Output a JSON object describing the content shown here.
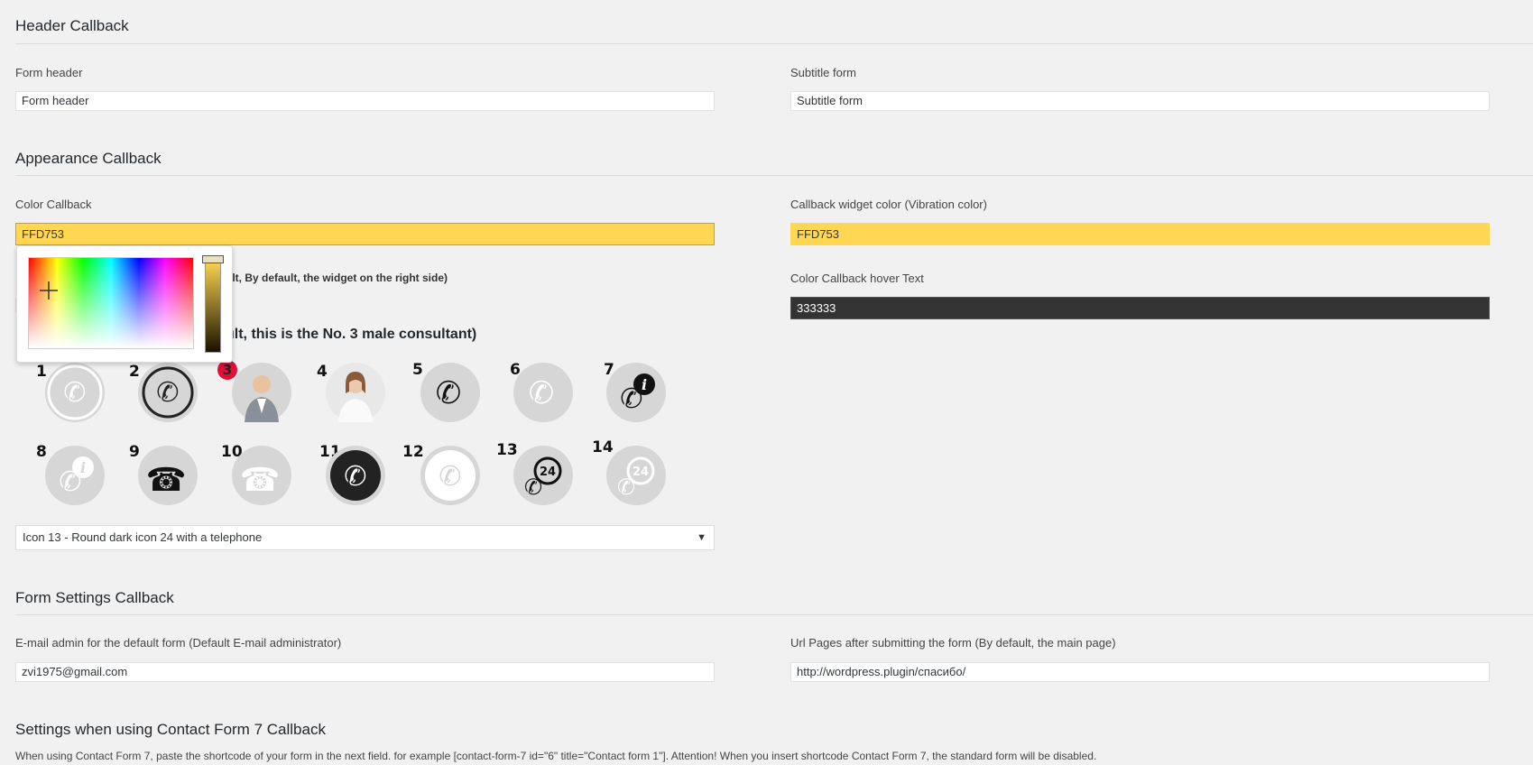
{
  "sections": {
    "header": "Header Callback",
    "appearance": "Appearance Callback",
    "form_settings": "Form Settings Callback",
    "cf7": "Settings when using Contact Form 7 Callback"
  },
  "header_fields": {
    "form_header_label": "Form header",
    "form_header_value": "Form header",
    "subtitle_label": "Subtitle form",
    "subtitle_value": "Subtitle form"
  },
  "appearance": {
    "color_label": "Color Callback",
    "color_value": "FFD753",
    "widget_color_label": "Callback widget color (Vibration color)",
    "widget_color_value": "FFD753",
    "position_label_partial": "ult, By default, the widget on the right side)",
    "hover_text_label": "Color Callback hover Text",
    "hover_text_value": "333333",
    "icon_label_partial": "ult, this is the No. 3 male consultant)",
    "icon_numbers": [
      "1",
      "2",
      "3",
      "4",
      "5",
      "6",
      "7",
      "8",
      "9",
      "10",
      "11",
      "12",
      "13",
      "14"
    ],
    "selected_icon": "Icon 13 - Round dark icon 24 with a telephone",
    "select_arrow": "▼"
  },
  "form_settings": {
    "email_label": "E-mail admin for the default form (Default E-mail administrator)",
    "email_value": "zvi1975@gmail.com",
    "url_label": "Url Pages after submitting the form (By default, the main page)",
    "url_value": "http://wordpress.plugin/спасибо/"
  },
  "cf7": {
    "description": "When using Contact Form 7, paste the shortcode of your form in the next field. for example [contact-form-7 id=\"6\" title=\"Contact form 1\"]. Attention! When you insert shortcode Contact Form 7, the standard form will be disabled."
  },
  "colors": {
    "accent_yellow": "#FFD753",
    "dark_field": "#333333",
    "selected_badge": "#E0103A"
  }
}
